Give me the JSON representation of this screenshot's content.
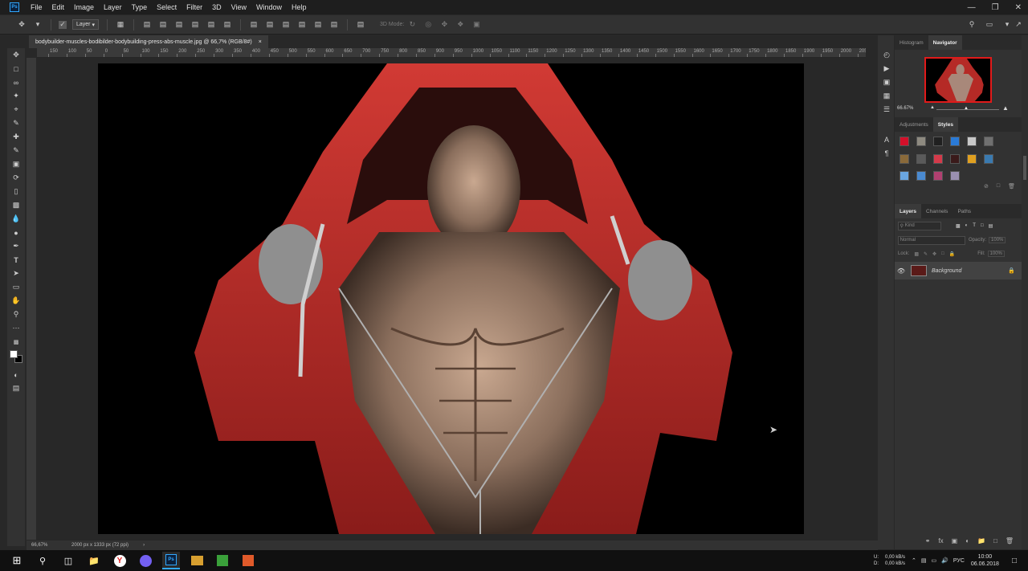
{
  "menubar": {
    "logo": "Ps",
    "items": [
      "File",
      "Edit",
      "Image",
      "Layer",
      "Type",
      "Select",
      "Filter",
      "3D",
      "View",
      "Window",
      "Help"
    ]
  },
  "options": {
    "auto_select_value": "Layer",
    "mode_label": "3D Mode:"
  },
  "document": {
    "tab_title": "bodybuilder-muscles-bodibilder-bodybuilding-press-abs-muscle.jpg @ 66,7% (RGB/8#)",
    "close_glyph": "×"
  },
  "ruler": {
    "ticks": [
      "150",
      "100",
      "50",
      "0",
      "50",
      "100",
      "150",
      "200",
      "250",
      "300",
      "350",
      "400",
      "450",
      "500",
      "550",
      "600",
      "650",
      "700",
      "750",
      "800",
      "850",
      "900",
      "950",
      "1000",
      "1050",
      "1100",
      "1150",
      "1200",
      "1250",
      "1300",
      "1350",
      "1400",
      "1450",
      "1500",
      "1550",
      "1600",
      "1650",
      "1700",
      "1750",
      "1800",
      "1850",
      "1900",
      "1950",
      "2000",
      "2050",
      "21"
    ]
  },
  "status": {
    "zoom": "66,67%",
    "info": "2000 px x 1333 px (72 ppi)",
    "arrow": "›"
  },
  "navigator": {
    "tabs": [
      "Histogram",
      "Navigator"
    ],
    "zoom": "66.67%"
  },
  "styles_panel": {
    "tabs": [
      "Adjustments",
      "Styles"
    ],
    "swatches": [
      "#d4102a",
      "#8e8a80",
      "#202020",
      "#2a7ad6",
      "#c8c8c8",
      "#707070",
      "#8a6a3a",
      "#5a5a5a",
      "#d43a4a",
      "#3a1a1a",
      "#e0a020",
      "#3a7ab0",
      "#6aa6e0",
      "#4a8ad0",
      "#b04070",
      "#9a90b0"
    ]
  },
  "layers_panel": {
    "tabs": [
      "Layers",
      "Channels",
      "Paths"
    ],
    "kind_label": "Kind",
    "blend_mode": "Normal",
    "opacity_label": "Opacity:",
    "opacity_value": "100%",
    "lock_label": "Lock:",
    "fill_label": "Fill:",
    "fill_value": "100%",
    "layer_name": "Background"
  },
  "taskbar": {
    "tray_u": "U:",
    "tray_d": "D:",
    "speed_u": "0,00 kB/s",
    "speed_d": "0,00 kB/s",
    "lang": "РУС",
    "time": "10:00",
    "date": "06.06.2018"
  }
}
